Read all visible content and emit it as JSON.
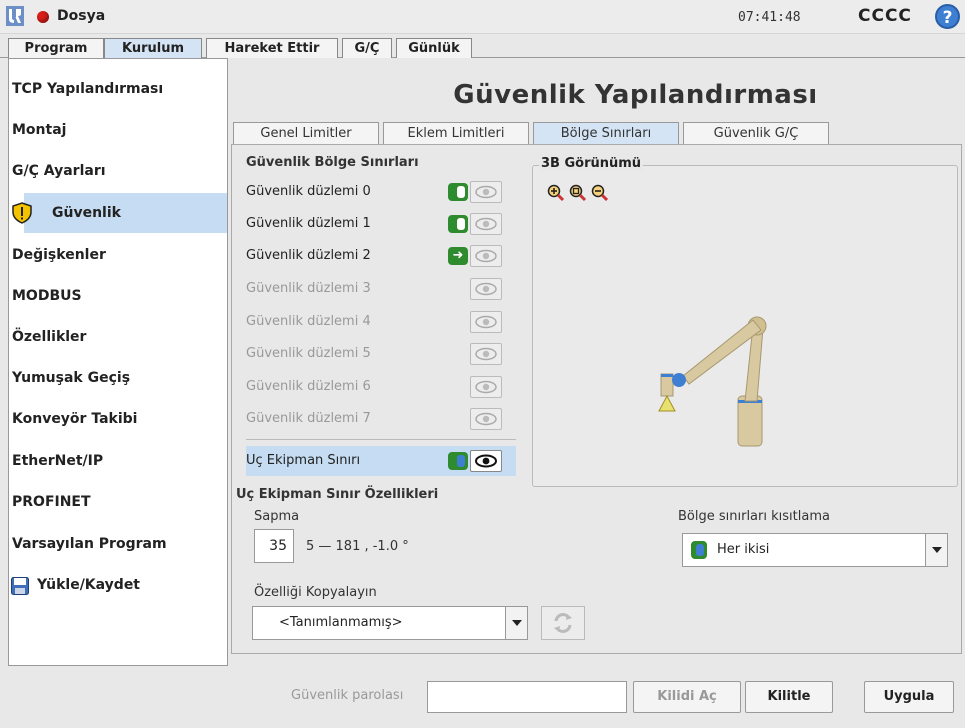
{
  "titlebar": {
    "menu_label": "Dosya",
    "time": "07:41:48",
    "robot_name": "CCCC",
    "help_glyph": "?"
  },
  "top_tabs": [
    {
      "label": "Program"
    },
    {
      "label": "Kurulum"
    },
    {
      "label": "Hareket Ettir"
    },
    {
      "label": "G/Ç"
    },
    {
      "label": "Günlük"
    }
  ],
  "sidebar": {
    "items": [
      {
        "label": "TCP Yapılandırması"
      },
      {
        "label": "Montaj"
      },
      {
        "label": "G/Ç Ayarları"
      },
      {
        "label": "Güvenlik"
      },
      {
        "label": "Değişkenler"
      },
      {
        "label": "MODBUS"
      },
      {
        "label": "Özellikler"
      },
      {
        "label": "Yumuşak Geçiş"
      },
      {
        "label": "Konveyör Takibi"
      },
      {
        "label": "EtherNet/IP"
      },
      {
        "label": "PROFINET"
      },
      {
        "label": "Varsayılan Program"
      },
      {
        "label": "Yükle/Kaydet"
      }
    ]
  },
  "main": {
    "title": "Güvenlik Yapılandırması",
    "sub_tabs": [
      {
        "label": "Genel Limitler"
      },
      {
        "label": "Eklem Limitleri"
      },
      {
        "label": "Bölge Sınırları"
      },
      {
        "label": "Güvenlik G/Ç"
      }
    ],
    "boundaries_title": "Güvenlik Bölge Sınırları",
    "planes": [
      {
        "label": "Güvenlik düzlemi 0"
      },
      {
        "label": "Güvenlik düzlemi 1"
      },
      {
        "label": "Güvenlik düzlemi 2"
      },
      {
        "label": "Güvenlik düzlemi 3"
      },
      {
        "label": "Güvenlik düzlemi 4"
      },
      {
        "label": "Güvenlik düzlemi 5"
      },
      {
        "label": "Güvenlik düzlemi 6"
      },
      {
        "label": "Güvenlik düzlemi 7"
      }
    ],
    "tool_boundary": {
      "label": "Uç Ekipman Sınırı"
    },
    "view3d_title": "3B Görünümü",
    "tool_props_title": "Uç Ekipman Sınır Özellikleri",
    "deviation_label": "Sapma",
    "deviation_value": "35",
    "deviation_range": "5 — 181 , -1.0 °",
    "copy_label": "Özelliği Kopyalayın",
    "copy_value": "<Tanımlanmamış>",
    "restriction_label": "Bölge sınırları kısıtlama",
    "restriction_value": "Her ikisi"
  },
  "bottom": {
    "password_label": "Güvenlik parolası",
    "unlock_label": "Kilidi Aç",
    "lock_label": "Kilitle",
    "apply_label": "Uygula"
  }
}
